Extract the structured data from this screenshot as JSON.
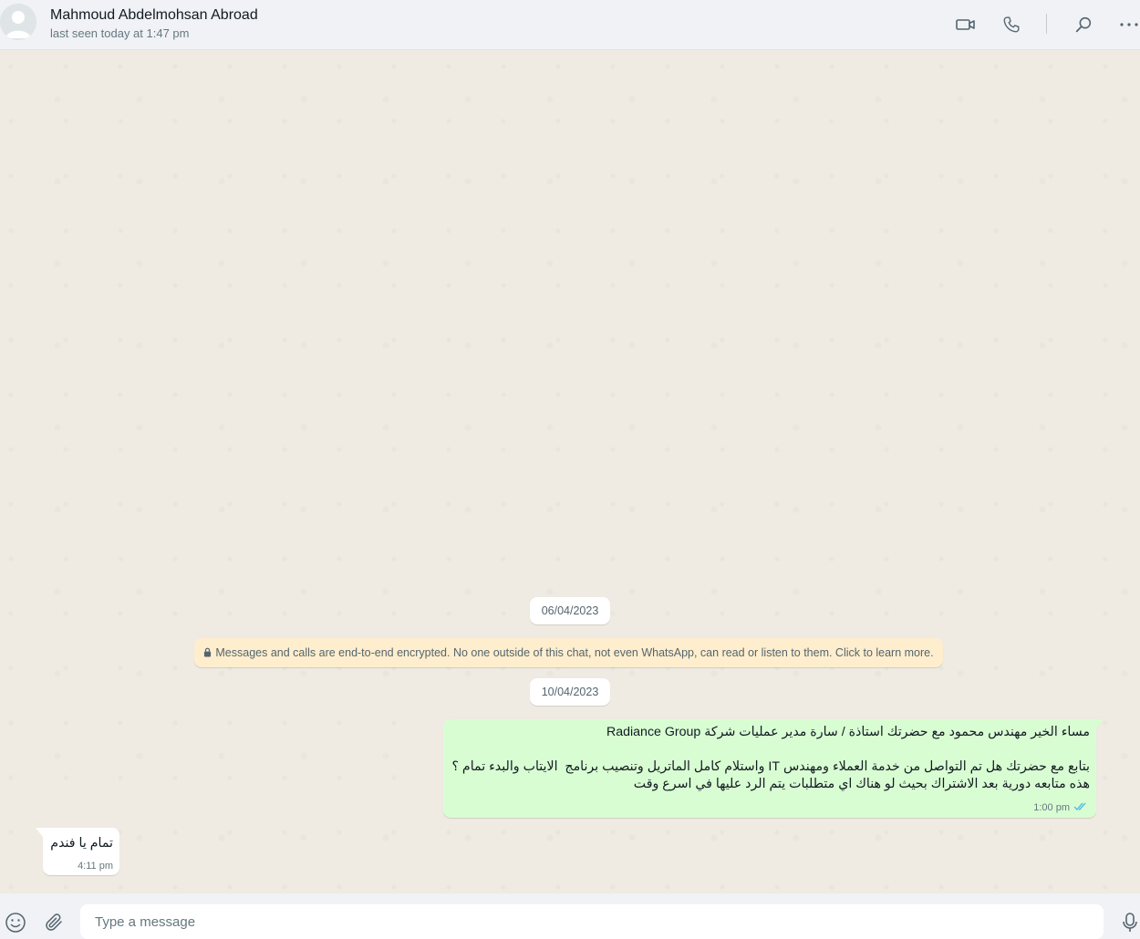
{
  "header": {
    "contact_name": "Mahmoud Abdelmohsan Abroad",
    "last_seen": "last seen today at 1:47 pm",
    "icons": [
      "video-call-icon",
      "voice-call-icon",
      "search-icon",
      "menu-icon"
    ]
  },
  "chat": {
    "date_chips": [
      "06/04/2023",
      "10/04/2023"
    ],
    "encryption_notice": "Messages and calls are end-to-end encrypted. No one outside of this chat, not even WhatsApp, can read or listen to them. Click to learn more.",
    "messages": [
      {
        "direction": "outgoing",
        "text": "مساء الخير مهندس محمود مع حضرتك استاذة / سارة مدير عمليات شركة Radiance Group\n\nبتابع مع حضرتك هل تم التواصل من خدمة العملاء ومهندس IT واستلام كامل الماتريل وتنصيب برنامج  الايتاب والبدء تمام ؟\nهذه متابعه دورية بعد الاشتراك بحيث لو هناك اي متطلبات يتم الرد عليها في اسرع وقت",
        "time": "1:00 pm",
        "status": "read"
      },
      {
        "direction": "incoming",
        "text": "تمام يا فندم",
        "time": "4:11 pm"
      }
    ]
  },
  "composer": {
    "placeholder": "Type a message",
    "value": ""
  },
  "colors": {
    "outgoing_bubble": "#d9fdd3",
    "incoming_bubble": "#ffffff",
    "notice_bg": "#ffeecd",
    "read_ticks": "#53bdeb"
  }
}
